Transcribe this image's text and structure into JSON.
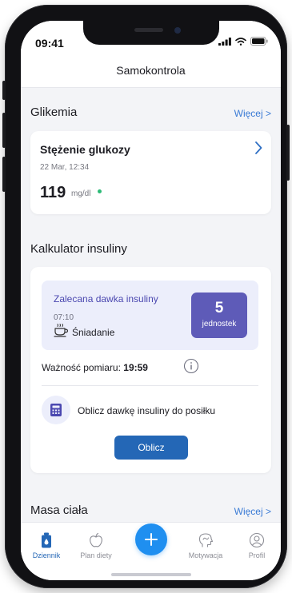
{
  "status_bar": {
    "time": "09:41"
  },
  "header": {
    "title": "Samokontrola"
  },
  "glikemia": {
    "section_title": "Glikemia",
    "more_link": "Więcej >",
    "card": {
      "title": "Stężenie glukozy",
      "date": "22 Mar, 12:34",
      "value": "119",
      "unit": "mg/dl",
      "status_color": "#2dbb77"
    }
  },
  "insulin": {
    "section_title": "Kalkulator insuliny",
    "recommended_label": "Zalecana dawka insuliny",
    "time": "07:10",
    "meal": "Śniadanie",
    "units_value": "5",
    "units_label": "jednostek",
    "validity_label": "Ważność pomiaru:",
    "validity_value": "19:59",
    "calc_prompt": "Oblicz dawkę insuliny do posiłku",
    "calc_button": "Oblicz"
  },
  "body_mass": {
    "section_title": "Masa ciała",
    "more_link": "Więcej >"
  },
  "tab_bar": {
    "items": [
      {
        "label": "Dziennik",
        "icon": "bottle-icon",
        "active": true
      },
      {
        "label": "Plan diety",
        "icon": "apple-icon",
        "active": false
      },
      {
        "label": "",
        "icon": "plus-icon",
        "active": false
      },
      {
        "label": "Motywacja",
        "icon": "head-icon",
        "active": false
      },
      {
        "label": "Profil",
        "icon": "user-icon",
        "active": false
      }
    ]
  },
  "colors": {
    "accent": "#2467b6",
    "link": "#3a7bd5",
    "badge": "#5e5bb8",
    "highlight_bg": "#eceefb",
    "fab": "#1f8ff0"
  }
}
